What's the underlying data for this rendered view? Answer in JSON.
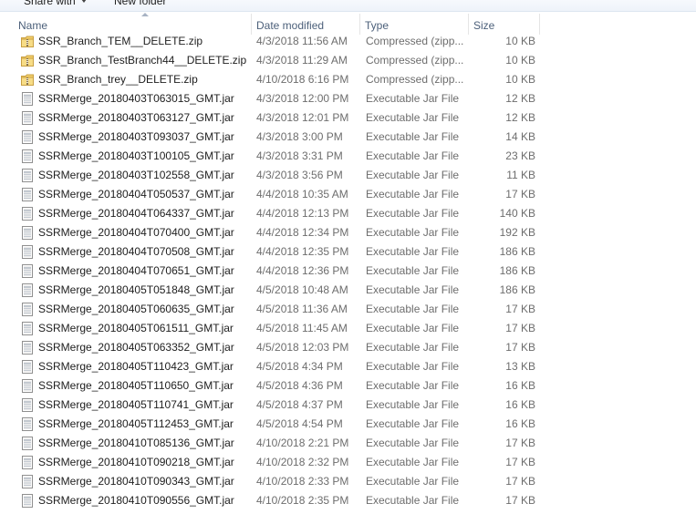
{
  "toolbar": {
    "share_with_label": "Share with",
    "new_folder_label": "New folder"
  },
  "columns": {
    "name": "Name",
    "date_modified": "Date modified",
    "type": "Type",
    "size": "Size"
  },
  "files": [
    {
      "name": "SSR_Branch_TEM__DELETE.zip",
      "date": "4/3/2018 11:56 AM",
      "type": "Compressed (zipp...",
      "size": "10 KB",
      "icon": "zip-folder-icon"
    },
    {
      "name": "SSR_Branch_TestBranch44__DELETE.zip",
      "date": "4/3/2018 11:29 AM",
      "type": "Compressed (zipp...",
      "size": "10 KB",
      "icon": "zip-folder-icon"
    },
    {
      "name": "SSR_Branch_trey__DELETE.zip",
      "date": "4/10/2018 6:16 PM",
      "type": "Compressed (zipp...",
      "size": "10 KB",
      "icon": "zip-folder-icon"
    },
    {
      "name": "SSRMerge_20180403T063015_GMT.jar",
      "date": "4/3/2018 12:00 PM",
      "type": "Executable Jar File",
      "size": "12 KB",
      "icon": "jar-file-icon"
    },
    {
      "name": "SSRMerge_20180403T063127_GMT.jar",
      "date": "4/3/2018 12:01 PM",
      "type": "Executable Jar File",
      "size": "12 KB",
      "icon": "jar-file-icon"
    },
    {
      "name": "SSRMerge_20180403T093037_GMT.jar",
      "date": "4/3/2018 3:00 PM",
      "type": "Executable Jar File",
      "size": "14 KB",
      "icon": "jar-file-icon"
    },
    {
      "name": "SSRMerge_20180403T100105_GMT.jar",
      "date": "4/3/2018 3:31 PM",
      "type": "Executable Jar File",
      "size": "23 KB",
      "icon": "jar-file-icon"
    },
    {
      "name": "SSRMerge_20180403T102558_GMT.jar",
      "date": "4/3/2018 3:56 PM",
      "type": "Executable Jar File",
      "size": "11 KB",
      "icon": "jar-file-icon"
    },
    {
      "name": "SSRMerge_20180404T050537_GMT.jar",
      "date": "4/4/2018 10:35 AM",
      "type": "Executable Jar File",
      "size": "17 KB",
      "icon": "jar-file-icon"
    },
    {
      "name": "SSRMerge_20180404T064337_GMT.jar",
      "date": "4/4/2018 12:13 PM",
      "type": "Executable Jar File",
      "size": "140 KB",
      "icon": "jar-file-icon"
    },
    {
      "name": "SSRMerge_20180404T070400_GMT.jar",
      "date": "4/4/2018 12:34 PM",
      "type": "Executable Jar File",
      "size": "192 KB",
      "icon": "jar-file-icon"
    },
    {
      "name": "SSRMerge_20180404T070508_GMT.jar",
      "date": "4/4/2018 12:35 PM",
      "type": "Executable Jar File",
      "size": "186 KB",
      "icon": "jar-file-icon"
    },
    {
      "name": "SSRMerge_20180404T070651_GMT.jar",
      "date": "4/4/2018 12:36 PM",
      "type": "Executable Jar File",
      "size": "186 KB",
      "icon": "jar-file-icon"
    },
    {
      "name": "SSRMerge_20180405T051848_GMT.jar",
      "date": "4/5/2018 10:48 AM",
      "type": "Executable Jar File",
      "size": "186 KB",
      "icon": "jar-file-icon"
    },
    {
      "name": "SSRMerge_20180405T060635_GMT.jar",
      "date": "4/5/2018 11:36 AM",
      "type": "Executable Jar File",
      "size": "17 KB",
      "icon": "jar-file-icon"
    },
    {
      "name": "SSRMerge_20180405T061511_GMT.jar",
      "date": "4/5/2018 11:45 AM",
      "type": "Executable Jar File",
      "size": "17 KB",
      "icon": "jar-file-icon"
    },
    {
      "name": "SSRMerge_20180405T063352_GMT.jar",
      "date": "4/5/2018 12:03 PM",
      "type": "Executable Jar File",
      "size": "17 KB",
      "icon": "jar-file-icon"
    },
    {
      "name": "SSRMerge_20180405T110423_GMT.jar",
      "date": "4/5/2018 4:34 PM",
      "type": "Executable Jar File",
      "size": "13 KB",
      "icon": "jar-file-icon"
    },
    {
      "name": "SSRMerge_20180405T110650_GMT.jar",
      "date": "4/5/2018 4:36 PM",
      "type": "Executable Jar File",
      "size": "16 KB",
      "icon": "jar-file-icon"
    },
    {
      "name": "SSRMerge_20180405T110741_GMT.jar",
      "date": "4/5/2018 4:37 PM",
      "type": "Executable Jar File",
      "size": "16 KB",
      "icon": "jar-file-icon"
    },
    {
      "name": "SSRMerge_20180405T112453_GMT.jar",
      "date": "4/5/2018 4:54 PM",
      "type": "Executable Jar File",
      "size": "16 KB",
      "icon": "jar-file-icon"
    },
    {
      "name": "SSRMerge_20180410T085136_GMT.jar",
      "date": "4/10/2018 2:21 PM",
      "type": "Executable Jar File",
      "size": "17 KB",
      "icon": "jar-file-icon"
    },
    {
      "name": "SSRMerge_20180410T090218_GMT.jar",
      "date": "4/10/2018 2:32 PM",
      "type": "Executable Jar File",
      "size": "17 KB",
      "icon": "jar-file-icon"
    },
    {
      "name": "SSRMerge_20180410T090343_GMT.jar",
      "date": "4/10/2018 2:33 PM",
      "type": "Executable Jar File",
      "size": "17 KB",
      "icon": "jar-file-icon"
    },
    {
      "name": "SSRMerge_20180410T090556_GMT.jar",
      "date": "4/10/2018 2:35 PM",
      "type": "Executable Jar File",
      "size": "17 KB",
      "icon": "jar-file-icon"
    }
  ],
  "colors": {
    "header_text": "#4c607a",
    "secondary_text": "#6d6d6d",
    "primary_text": "#1e1e1e",
    "zip_folder": "#e8c15a"
  }
}
